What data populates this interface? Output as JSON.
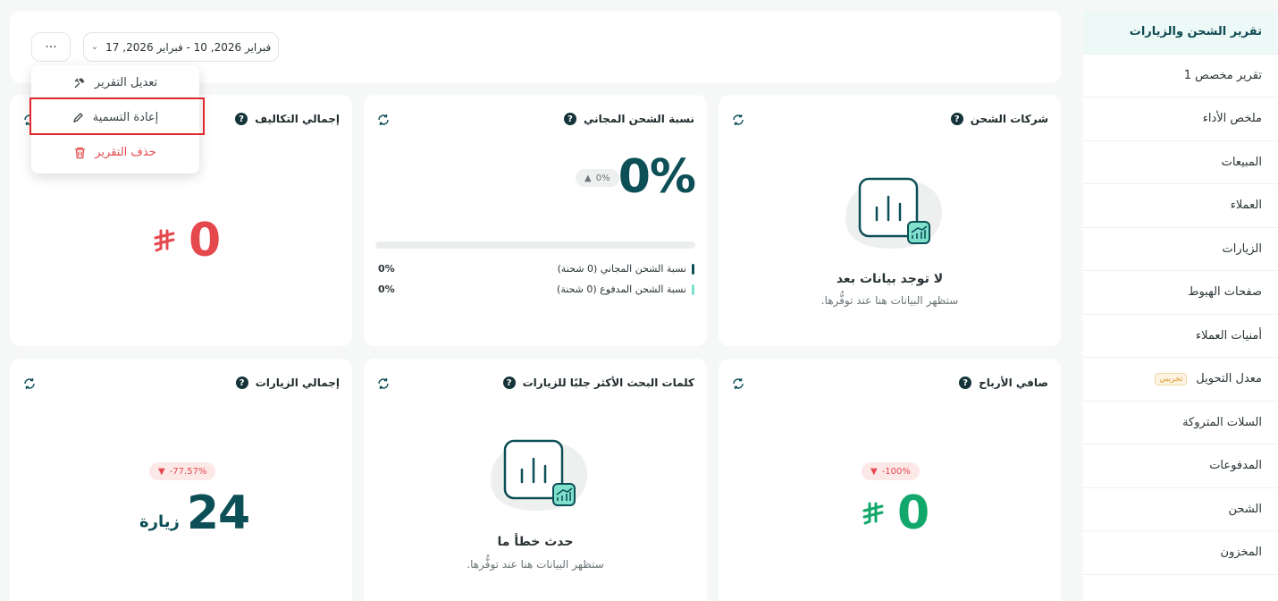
{
  "sidebar": {
    "items": [
      {
        "label": "تقرير الشحن والزيارات",
        "active": true
      },
      {
        "label": "تقرير مخصص 1"
      },
      {
        "label": "ملخص الأداء"
      },
      {
        "label": "المبيعات"
      },
      {
        "label": "العملاء"
      },
      {
        "label": "الزيارات"
      },
      {
        "label": "صفحات الهبوط"
      },
      {
        "label": "أمنيات العملاء"
      },
      {
        "label": "معدل التحويل",
        "badge": "تجريبي"
      },
      {
        "label": "السلات المتروكة"
      },
      {
        "label": "المدفوعات"
      },
      {
        "label": "الشحن"
      },
      {
        "label": "المخزون"
      }
    ]
  },
  "toolbar": {
    "date_range": "فبراير 2026, 10  -  فبراير 2026, 17",
    "more_label": "···"
  },
  "menu": {
    "edit": "تعديل التقرير",
    "rename": "إعادة التسمية",
    "delete": "حذف التقرير"
  },
  "cards": {
    "shipping_companies": {
      "title": "شركات الشحن",
      "empty_title": "لا توجد بيانات بعد",
      "empty_sub": "ستظهر البيانات هنا عند توفُّرها."
    },
    "free_shipping": {
      "title": "نسبة الشحن المجاني",
      "value": "0%",
      "change": "0%",
      "progress": 0,
      "legend": [
        {
          "label": "نسبة الشحن المجاني (0 شحنة)",
          "value": "0%",
          "color": "#0d4f57"
        },
        {
          "label": "نسبة الشحن المدفوع (0 شحنة)",
          "value": "0%",
          "color": "#7fe0cc"
        }
      ]
    },
    "total_costs": {
      "title": "إجمالي التكاليف",
      "value": "0",
      "currency": "⃁"
    },
    "net_profit": {
      "title": "صافي الأرباح",
      "value": "0",
      "change": "-100%"
    },
    "top_keywords": {
      "title": "كلمات البحث الأكثر جلبًا للزيارات",
      "empty_title": "حدث خطأ ما",
      "empty_sub": "ستظهر البيانات هنا عند توفُّرها."
    },
    "total_visits": {
      "title": "إجمالي الزيارات",
      "value": "24",
      "unit": "زيارة",
      "change": "-77.57%"
    }
  },
  "colors": {
    "brand_dark": "#0d4f57",
    "negative": "#e5484d",
    "positive": "#12a86b"
  }
}
